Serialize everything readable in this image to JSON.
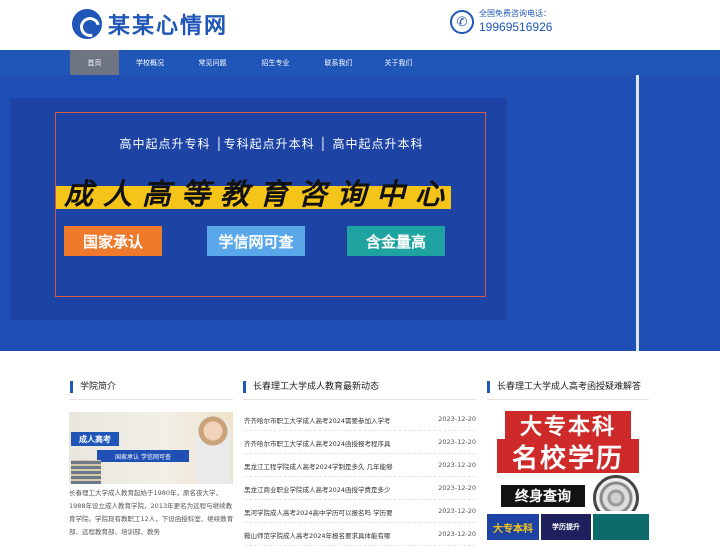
{
  "header": {
    "logo_text": "某某心情网",
    "phone_label": "全国免费咨询电话：",
    "phone_number": "19969516926"
  },
  "nav": {
    "items": [
      {
        "label": "首页",
        "active": true
      },
      {
        "label": "学校概况"
      },
      {
        "label": "常见问题"
      },
      {
        "label": "招生专业"
      },
      {
        "label": "联系我们"
      },
      {
        "label": "关于我们"
      }
    ]
  },
  "banner": {
    "tagline": "高中起点升专科 │专科起点升本科 │ 高中起点升本科",
    "headline": "成人高等教育咨询中心",
    "badges": [
      "国家承认",
      "学信网可查",
      "含金量高"
    ]
  },
  "about": {
    "title": "学院简介",
    "image_pill": "成人高考",
    "image_strip": "国家承认 学信网可查",
    "text": "长春理工大学成人教育起始于1980年，原名夜大学，1988年设立成人教育学院，2013年更名为远程与继续教育学院。学院现有教职工12人，下设函授科室、继续教育部、远程教育部、培训部、教务"
  },
  "news": {
    "title": "长春理工大学成人教育最新动态",
    "items": [
      {
        "title": "齐齐哈尔市职工大学成人高考2024需要参加入学考",
        "date": "2023-12-20"
      },
      {
        "title": "齐齐哈尔市职工大学成人高考2024函授报考程序具",
        "date": "2023-12-20"
      },
      {
        "title": "黑龙江工程学院成人高考2024学制是多久 几年能够",
        "date": "2023-12-20"
      },
      {
        "title": "黑龙江商业职业学院成人高考2024函授学费是多少",
        "date": "2023-12-20"
      },
      {
        "title": "黑河学院成人高考2024高中学历可以报名吗 学历要",
        "date": "2023-12-20"
      },
      {
        "title": "鞍山师范学院成人高考2024年报名要求具体能有哪",
        "date": "2023-12-20"
      }
    ]
  },
  "faq": {
    "title": "长春理工大学成人高考函授疑难解答",
    "image_line1": "大专本科",
    "image_line2": "名校学历",
    "image_tag": "终身查询",
    "thumbs": [
      "大专本科",
      "学历提升",
      ""
    ]
  },
  "colors": {
    "brand": "#1f56b8",
    "nav_active": "#6f7482",
    "banner": "#1f4fb5",
    "accent_yellow": "#f5c419"
  }
}
